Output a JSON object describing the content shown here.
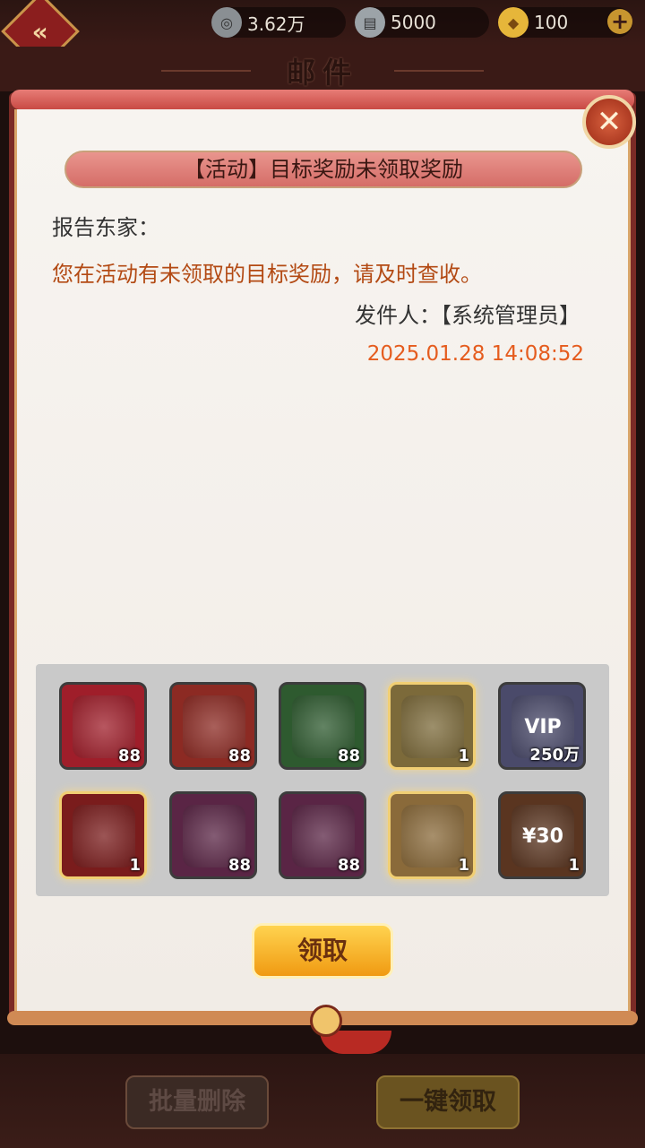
{
  "header": {
    "title": "邮件",
    "currencies": [
      {
        "icon": "coin-icon",
        "value": "3.62万"
      },
      {
        "icon": "scroll-icon",
        "value": "5000"
      },
      {
        "icon": "gold-ingot-icon",
        "value": "100"
      }
    ]
  },
  "mail": {
    "subject": "【活动】目标奖励未领取奖励",
    "greeting": "报告东家：",
    "body": "您在活动有未领取的目标奖励，请及时查收。",
    "sender": "发件人：【系统管理员】",
    "date": "2025.01.28 14:08:52"
  },
  "rewards": [
    {
      "name": "fire-orb",
      "count": "88",
      "color": "#9f1e2a",
      "gold": false
    },
    {
      "name": "lucky-bag",
      "count": "88",
      "color": "#8c2a23",
      "gold": false
    },
    {
      "name": "gem-chest",
      "count": "88",
      "color": "#2e5a2f",
      "gold": false
    },
    {
      "name": "robe-green",
      "count": "1",
      "color": "#7c6a3a",
      "gold": true
    },
    {
      "name": "vip-badge",
      "count": "250万",
      "color": "#4a4a6a",
      "gold": false
    },
    {
      "name": "robe-red",
      "count": "1",
      "color": "#7a1c1c",
      "gold": true
    },
    {
      "name": "jade-pendant",
      "count": "88",
      "color": "#5a2545",
      "gold": false
    },
    {
      "name": "coin-chest",
      "count": "88",
      "color": "#5a2545",
      "gold": false
    },
    {
      "name": "robe-white",
      "count": "1",
      "color": "#8a6a3a",
      "gold": true
    },
    {
      "name": "voucher",
      "count": "1",
      "color": "#5a3520",
      "gold": false
    }
  ],
  "vip_label": "VIP",
  "voucher_label": "¥30",
  "claim_label": "领取",
  "footer": {
    "batch_delete": "批量删除",
    "claim_all": "一键领取"
  }
}
